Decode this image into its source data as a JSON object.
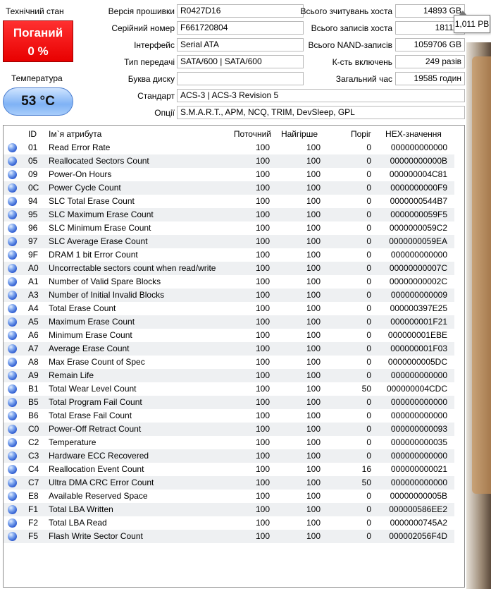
{
  "health": {
    "label": "Технічний стан",
    "status": "Поганий",
    "percent": "0 %"
  },
  "temperature": {
    "label": "Температура",
    "value": "53 °C"
  },
  "info": {
    "firmware_label": "Версія прошивки",
    "firmware": "R0427D16",
    "serial_label": "Серійний номер",
    "serial": "F661720804",
    "interface_label": "Інтерфейс",
    "interface": "Serial ATA",
    "transfer_label": "Тип передачі",
    "transfer": "SATA/600 | SATA/600",
    "drive_letter_label": "Буква диску",
    "drive_letter": "",
    "standard_label": "Стандарт",
    "standard": "ACS-3 | ACS-3 Revision 5",
    "features_label": "Опції",
    "features": "S.M.A.R.T., APM, NCQ, TRIM, DevSleep, GPL",
    "host_reads_label": "Всього зчитувань хоста",
    "host_reads": "14893 GB",
    "host_writes_label": "Всього записів хоста",
    "host_writes": "181111",
    "nand_writes_label": "Всього NAND-записів",
    "nand_writes": "1059706 GB",
    "power_on_count_label": "К-сть включень",
    "power_on_count": "249 разів",
    "power_on_hours_label": "Загальний час",
    "power_on_hours": "19585 годин"
  },
  "tooltip": "1,011 PB",
  "table": {
    "headers": {
      "id": "ID",
      "name": "Ім`я атрибута",
      "current": "Поточний",
      "worst": "Найгірше",
      "threshold": "Поріг",
      "raw": "HEX-значення"
    },
    "rows": [
      {
        "id": "01",
        "name": "Read Error Rate",
        "current": "100",
        "worst": "100",
        "threshold": "0",
        "raw": "000000000000"
      },
      {
        "id": "05",
        "name": "Reallocated Sectors Count",
        "current": "100",
        "worst": "100",
        "threshold": "0",
        "raw": "00000000000B"
      },
      {
        "id": "09",
        "name": "Power-On Hours",
        "current": "100",
        "worst": "100",
        "threshold": "0",
        "raw": "000000004C81"
      },
      {
        "id": "0C",
        "name": "Power Cycle Count",
        "current": "100",
        "worst": "100",
        "threshold": "0",
        "raw": "0000000000F9"
      },
      {
        "id": "94",
        "name": "SLC Total Erase Count",
        "current": "100",
        "worst": "100",
        "threshold": "0",
        "raw": "0000000544B7"
      },
      {
        "id": "95",
        "name": "SLC Maximum Erase Count",
        "current": "100",
        "worst": "100",
        "threshold": "0",
        "raw": "0000000059F5"
      },
      {
        "id": "96",
        "name": "SLC Minimum Erase Count",
        "current": "100",
        "worst": "100",
        "threshold": "0",
        "raw": "0000000059C2"
      },
      {
        "id": "97",
        "name": "SLC Average Erase Count",
        "current": "100",
        "worst": "100",
        "threshold": "0",
        "raw": "0000000059EA"
      },
      {
        "id": "9F",
        "name": "DRAM 1 bit Error Count",
        "current": "100",
        "worst": "100",
        "threshold": "0",
        "raw": "000000000000"
      },
      {
        "id": "A0",
        "name": "Uncorrectable sectors count when read/write",
        "current": "100",
        "worst": "100",
        "threshold": "0",
        "raw": "00000000007C"
      },
      {
        "id": "A1",
        "name": "Number of Valid Spare Blocks",
        "current": "100",
        "worst": "100",
        "threshold": "0",
        "raw": "00000000002C"
      },
      {
        "id": "A3",
        "name": "Number of Initial Invalid Blocks",
        "current": "100",
        "worst": "100",
        "threshold": "0",
        "raw": "000000000009"
      },
      {
        "id": "A4",
        "name": "Total Erase Count",
        "current": "100",
        "worst": "100",
        "threshold": "0",
        "raw": "000000397E25"
      },
      {
        "id": "A5",
        "name": "Maximum Erase Count",
        "current": "100",
        "worst": "100",
        "threshold": "0",
        "raw": "000000001F21"
      },
      {
        "id": "A6",
        "name": "Minimum Erase Count",
        "current": "100",
        "worst": "100",
        "threshold": "0",
        "raw": "000000001EBE"
      },
      {
        "id": "A7",
        "name": "Average Erase Count",
        "current": "100",
        "worst": "100",
        "threshold": "0",
        "raw": "000000001F03"
      },
      {
        "id": "A8",
        "name": "Max Erase Count of Spec",
        "current": "100",
        "worst": "100",
        "threshold": "0",
        "raw": "0000000005DC"
      },
      {
        "id": "A9",
        "name": "Remain Life",
        "current": "100",
        "worst": "100",
        "threshold": "0",
        "raw": "000000000000"
      },
      {
        "id": "B1",
        "name": "Total Wear Level Count",
        "current": "100",
        "worst": "100",
        "threshold": "50",
        "raw": "000000004CDC"
      },
      {
        "id": "B5",
        "name": "Total Program Fail Count",
        "current": "100",
        "worst": "100",
        "threshold": "0",
        "raw": "000000000000"
      },
      {
        "id": "B6",
        "name": "Total Erase Fail Count",
        "current": "100",
        "worst": "100",
        "threshold": "0",
        "raw": "000000000000"
      },
      {
        "id": "C0",
        "name": "Power-Off Retract Count",
        "current": "100",
        "worst": "100",
        "threshold": "0",
        "raw": "000000000093"
      },
      {
        "id": "C2",
        "name": "Temperature",
        "current": "100",
        "worst": "100",
        "threshold": "0",
        "raw": "000000000035"
      },
      {
        "id": "C3",
        "name": "Hardware ECC Recovered",
        "current": "100",
        "worst": "100",
        "threshold": "0",
        "raw": "000000000000"
      },
      {
        "id": "C4",
        "name": "Reallocation Event Count",
        "current": "100",
        "worst": "100",
        "threshold": "16",
        "raw": "000000000021"
      },
      {
        "id": "C7",
        "name": "Ultra DMA CRC Error Count",
        "current": "100",
        "worst": "100",
        "threshold": "50",
        "raw": "000000000000"
      },
      {
        "id": "E8",
        "name": "Available Reserved Space",
        "current": "100",
        "worst": "100",
        "threshold": "0",
        "raw": "00000000005B"
      },
      {
        "id": "F1",
        "name": "Total LBA Written",
        "current": "100",
        "worst": "100",
        "threshold": "0",
        "raw": "000000586EE2"
      },
      {
        "id": "F2",
        "name": "Total LBA Read",
        "current": "100",
        "worst": "100",
        "threshold": "0",
        "raw": "0000000745A2"
      },
      {
        "id": "F5",
        "name": "Flash Write Sector Count",
        "current": "100",
        "worst": "100",
        "threshold": "0",
        "raw": "000002056F4D"
      }
    ]
  }
}
